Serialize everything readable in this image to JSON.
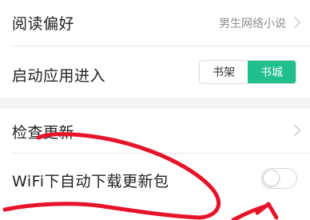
{
  "settings": {
    "reading_pref": {
      "title": "阅读偏好",
      "value": "男生网络小说"
    },
    "startup_entry": {
      "title": "启动应用进入",
      "options": [
        "书架",
        "书城"
      ],
      "selected": "书城"
    },
    "check_update": {
      "title": "检查更新"
    },
    "wifi_auto_download": {
      "title": "WiFi下自动下载更新包",
      "enabled": false
    }
  },
  "colors": {
    "accent": "#20bf8e",
    "annotation": "#e5142a"
  }
}
